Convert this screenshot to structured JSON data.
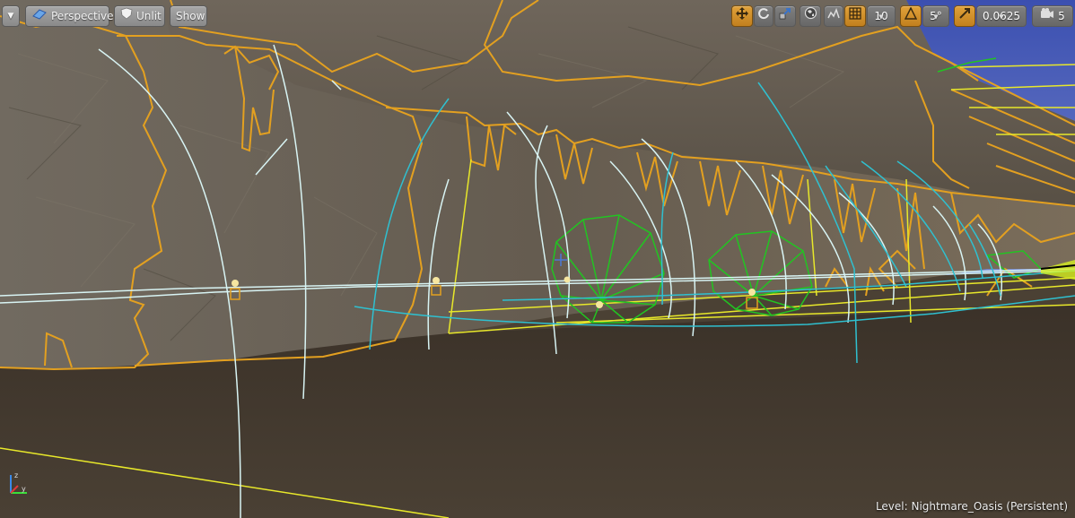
{
  "toolbar_left": {
    "view_mode": "Perspective",
    "lighting_mode": "Unlit",
    "show": "Show"
  },
  "toolbar_right": {
    "grid_snap_value": "10",
    "rotation_snap_value": "5°",
    "scale_snap_value": "0.0625",
    "camera_speed_value": "5"
  },
  "status": {
    "level_label": "Level:",
    "level_name": "Nightmare_Oasis (Persistent)"
  },
  "icons": {
    "menu": "chevron-down-icon",
    "perspective": "perspective-cube-icon",
    "unlit": "unlit-shield-icon",
    "translate": "translate-icon",
    "rotate": "rotate-icon",
    "scale": "scale-icon",
    "world": "world-space-icon",
    "surface_snap": "surface-snap-icon",
    "grid": "grid-icon",
    "angle": "angle-icon",
    "scale_snap": "scale-snap-icon",
    "camera": "camera-speed-icon"
  },
  "colors": {
    "toolbar_button": "#999999",
    "active_orange": "#d6921f",
    "mesh_outline": "#e3a020",
    "spline_white": "#d8f4f4",
    "spline_cyan": "#2fc0d0",
    "light_green": "#22c422",
    "volume_yellow": "#e8e82a",
    "floor": "#3e352a",
    "rock": "#6a6155"
  }
}
